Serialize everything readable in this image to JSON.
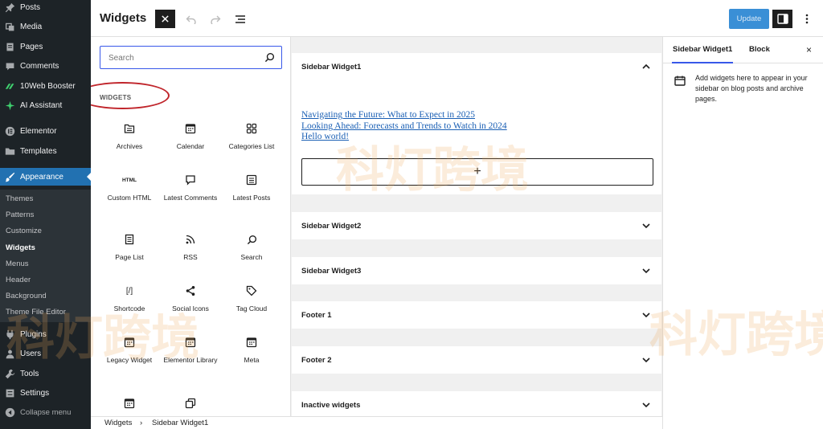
{
  "admin_menu": {
    "items": [
      {
        "label": "Posts",
        "icon": "pin-icon"
      },
      {
        "label": "Media",
        "icon": "media-icon"
      },
      {
        "label": "Pages",
        "icon": "page-icon"
      },
      {
        "label": "Comments",
        "icon": "comment-icon"
      },
      {
        "label": "10Web Booster",
        "icon": "booster-icon"
      },
      {
        "label": "AI Assistant",
        "icon": "sparkle-icon"
      },
      {
        "label": "Elementor",
        "icon": "elementor-icon"
      },
      {
        "label": "Templates",
        "icon": "folder-icon"
      },
      {
        "label": "Appearance",
        "icon": "brush-icon"
      },
      {
        "label": "Plugins",
        "icon": "plug-icon"
      },
      {
        "label": "Users",
        "icon": "user-icon"
      },
      {
        "label": "Tools",
        "icon": "wrench-icon"
      },
      {
        "label": "Settings",
        "icon": "settings-icon"
      }
    ],
    "submenu": [
      "Themes",
      "Patterns",
      "Customize",
      "Widgets",
      "Menus",
      "Header",
      "Background",
      "Theme File Editor"
    ],
    "collapse_label": "Collapse menu"
  },
  "header": {
    "title": "Widgets",
    "update_label": "Update"
  },
  "inserter": {
    "search_placeholder": "Search",
    "category_label": "WIDGETS",
    "blocks": [
      {
        "label": "Archives",
        "icon": "archive-icon"
      },
      {
        "label": "Calendar",
        "icon": "calendar-icon"
      },
      {
        "label": "Categories List",
        "icon": "categories-icon"
      },
      {
        "label": "Custom HTML",
        "icon": "html-icon",
        "icon_text": "HTML"
      },
      {
        "label": "Latest Comments",
        "icon": "comment-icon"
      },
      {
        "label": "Latest Posts",
        "icon": "posts-icon"
      },
      {
        "label": "Page List",
        "icon": "pagelist-icon"
      },
      {
        "label": "RSS",
        "icon": "rss-icon"
      },
      {
        "label": "Search",
        "icon": "search-icon"
      },
      {
        "label": "Shortcode",
        "icon": "shortcode-icon",
        "icon_text": "[/]"
      },
      {
        "label": "Social Icons",
        "icon": "share-icon"
      },
      {
        "label": "Tag Cloud",
        "icon": "tag-icon"
      },
      {
        "label": "Legacy Widget",
        "icon": "calendar-icon"
      },
      {
        "label": "Elementor Library",
        "icon": "calendar-icon"
      },
      {
        "label": "Meta",
        "icon": "calendar-icon"
      },
      {
        "label": "",
        "icon": "calendar-icon"
      },
      {
        "label": "",
        "icon": "copy-icon"
      }
    ]
  },
  "canvas": {
    "areas": [
      {
        "title": "Sidebar Widget1",
        "expanded": true
      },
      {
        "title": "Sidebar Widget2",
        "expanded": false
      },
      {
        "title": "Sidebar Widget3",
        "expanded": false
      },
      {
        "title": "Footer 1",
        "expanded": false
      },
      {
        "title": "Footer 2",
        "expanded": false
      },
      {
        "title": "Inactive widgets",
        "expanded": false
      }
    ],
    "recent_posts": [
      "Navigating the Future: What to Expect in 2025",
      "Looking Ahead: Forecasts and Trends to Watch in 2024",
      "Hello world!"
    ],
    "appender_label": "+"
  },
  "settings_panel": {
    "tabs": [
      "Sidebar Widget1",
      "Block"
    ],
    "close_label": "×",
    "description": "Add widgets here to appear in your sidebar on blog posts and archive pages."
  },
  "breadcrumb": {
    "items": [
      "Widgets",
      "Sidebar Widget1"
    ],
    "separator": "›"
  },
  "watermark": {
    "text": "科灯跨境"
  },
  "colors": {
    "admin_bg": "#1d2327",
    "admin_active": "#2271b1",
    "accent": "#3858e9",
    "update_button": "#3a8fd6",
    "highlight_ring": "#c0252b",
    "link": "#1a5fb4"
  }
}
